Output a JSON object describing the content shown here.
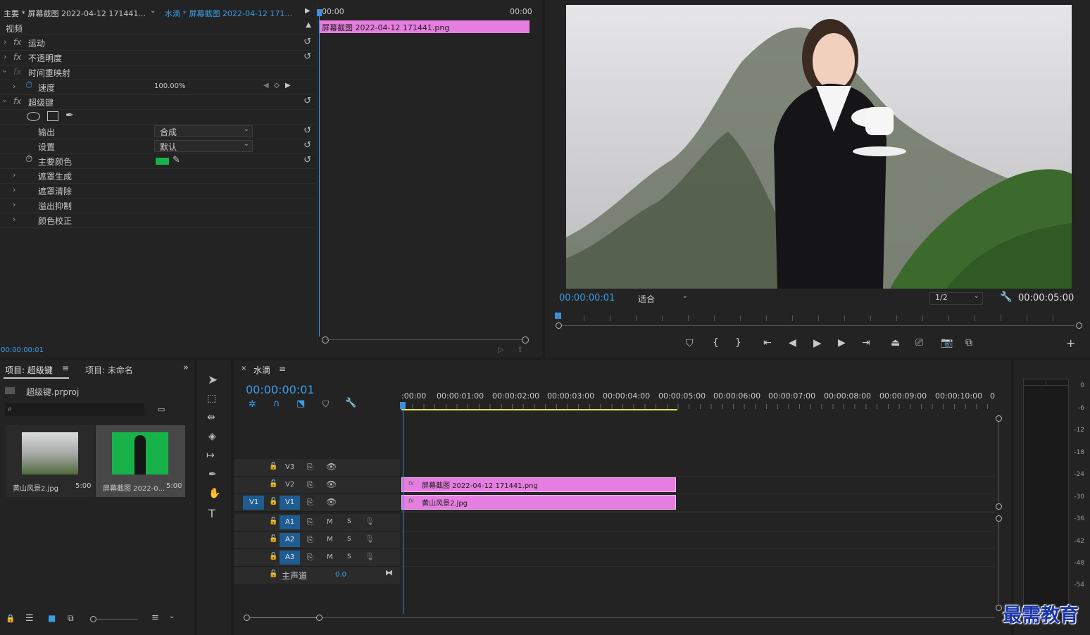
{
  "effect_controls": {
    "tab_master": "主要 * 屏幕截图 2022-04-12 171441...",
    "tab_seq": "水滴 * 屏幕截图 2022-04-12 171...",
    "section_video": "视频",
    "rows": [
      {
        "label": "运动"
      },
      {
        "label": "不透明度"
      },
      {
        "label": "时间重映射"
      },
      {
        "label": "速度",
        "value": "100.00%"
      },
      {
        "label": "超级键"
      },
      {
        "label": "输出",
        "value": "合成"
      },
      {
        "label": "设置",
        "value": "默认"
      },
      {
        "label": "主要颜色",
        "color": "#17b24a"
      },
      {
        "label": "遮罩生成"
      },
      {
        "label": "遮罩清除"
      },
      {
        "label": "溢出抑制"
      },
      {
        "label": "颜色校正"
      }
    ],
    "mini_timeline": {
      "start": "00:00",
      "end": "00:00",
      "clip": "屏幕截图 2022-04-12  171441.png"
    },
    "timecode": "00:00:00:01"
  },
  "program_monitor": {
    "timecode": "00:00:00:01",
    "fit": "适合",
    "resolution": "1/2",
    "duration": "00:00:05:00"
  },
  "project": {
    "tab1": "项目: 超级键",
    "tab2": "项目: 未命名",
    "file": "超级键.prproj",
    "items": [
      {
        "name": "黄山风景2.jpg",
        "duration": "5:00"
      },
      {
        "name": "屏幕截图 2022-0...",
        "duration": "5:00"
      }
    ]
  },
  "timeline": {
    "tab": "水滴",
    "timecode": "00:00:00:01",
    "ruler": [
      ":00:00",
      "00:00:01:00",
      "00:00:02:00",
      "00:00:03:00",
      "00:00:04:00",
      "00:00:05:00",
      "00:00:06:00",
      "00:00:07:00",
      "00:00:08:00",
      "00:00:09:00",
      "00:00:10:00",
      "0"
    ],
    "video_tracks": [
      "V3",
      "V2",
      "V1"
    ],
    "audio_tracks": [
      "A1",
      "A2",
      "A3"
    ],
    "master": "主声道",
    "master_value": "0.0",
    "source_v1": "V1",
    "clip_v2": "屏幕截图 2022-04-12  171441.png",
    "clip_v1": "黄山风景2.jpg",
    "m": "M",
    "s": "S"
  },
  "meter": {
    "labels": [
      "0",
      "-6",
      "-12",
      "-18",
      "-24",
      "-30",
      "-36",
      "-42",
      "-48",
      "-54"
    ]
  },
  "watermark": "最需教育"
}
